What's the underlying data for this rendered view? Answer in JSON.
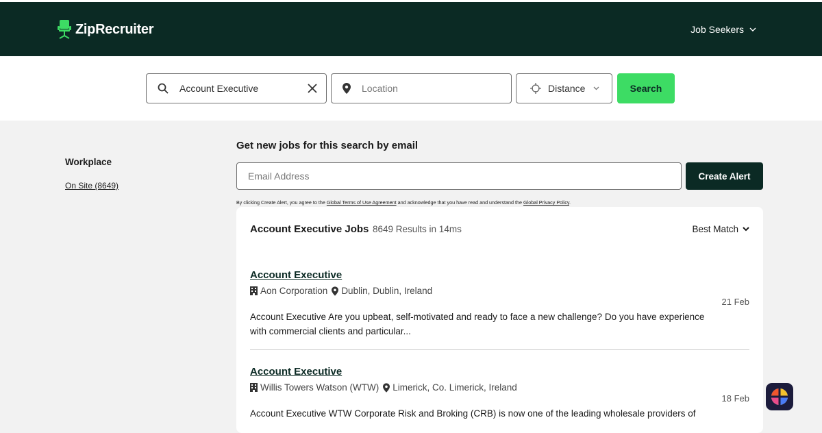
{
  "header": {
    "logo_text": "ZipRecruiter",
    "job_seekers_label": "Job Seekers",
    "brand_color": "#0b2a24",
    "accent_color": "#3ddc64"
  },
  "search": {
    "keyword_value": "Account Executive",
    "location_placeholder": "Location",
    "distance_label": "Distance",
    "search_button": "Search",
    "icons": [
      "search-icon",
      "close-icon",
      "location-pin-icon",
      "crosshair-icon",
      "chevron-down-icon"
    ]
  },
  "sidebar": {
    "title": "Workplace",
    "filters": [
      {
        "label": "On Site (8649)"
      }
    ]
  },
  "alert": {
    "title": "Get new jobs for this search by email",
    "email_placeholder": "Email Address",
    "button": "Create Alert",
    "legal_prefix": "By clicking Create Alert, you agree to the ",
    "terms_link": "Global Terms of Use Agreement",
    "legal_middle": " and acknowledge that you have read and understand the ",
    "privacy_link": "Global Privacy Policy",
    "legal_suffix": "."
  },
  "results": {
    "title": "Account Executive Jobs",
    "count": "8649 Results in 14ms",
    "sort_label": "Best Match",
    "jobs": [
      {
        "title": "Account Executive",
        "company": "Aon Corporation",
        "location": "Dublin, Dublin, Ireland",
        "date": "21 Feb",
        "description": "Account Executive Are you upbeat, self-motivated and ready to face a new challenge? Do you have experience with commercial clients and particular..."
      },
      {
        "title": "Account Executive",
        "company": "Willis Towers Watson (WTW)",
        "location": "Limerick, Co. Limerick, Ireland",
        "date": "18 Feb",
        "description": "Account Executive WTW Corporate Risk and Broking (CRB) is now one of the leading wholesale providers of"
      }
    ]
  }
}
